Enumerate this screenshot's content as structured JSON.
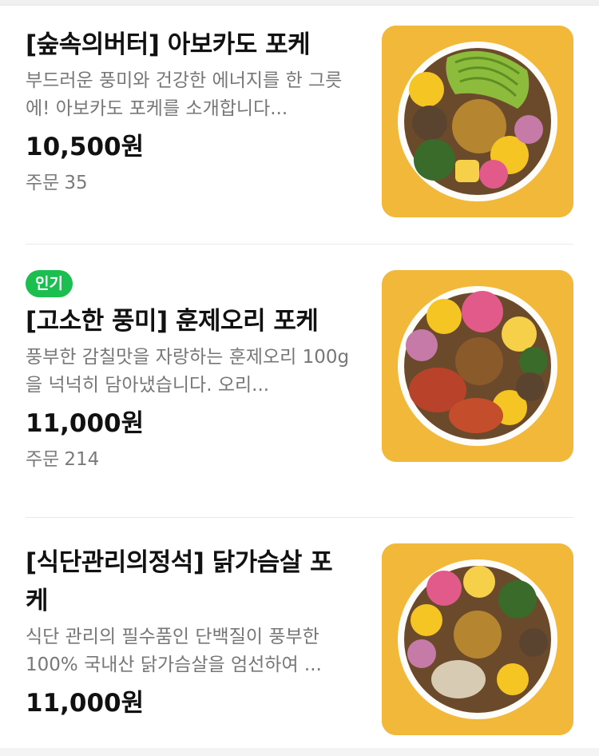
{
  "menu_items": [
    {
      "badge": "",
      "title": "[숲속의버터] 아보카도 포케",
      "description": "부드러운 풍미와 건강한 에너지를 한 그릇에! 아보카도 포케를 소개합니다...",
      "price": "10,500원",
      "orders_label": "주문",
      "orders_count": "35",
      "image_icon": "avocado-poke-bowl-photo"
    },
    {
      "badge": "인기",
      "title": "[고소한 풍미] 훈제오리 포케",
      "description": "풍부한 감칠맛을 자랑하는 훈제오리 100g을 넉넉히 담아냈습니다. 오리...",
      "price": "11,000원",
      "orders_label": "주문",
      "orders_count": "214",
      "image_icon": "smoked-duck-poke-bowl-photo"
    },
    {
      "badge": "",
      "title": "[식단관리의정석] 닭가슴살 포케",
      "description": "식단 관리의 필수품인 단백질이 풍부한 100% 국내산 닭가슴살을 엄선하여 ...",
      "price": "11,000원",
      "orders_label": "",
      "orders_count": "",
      "image_icon": "chicken-breast-poke-bowl-photo"
    }
  ],
  "colors": {
    "badge_bg": "#1bbf4f",
    "thumb_bg": "#f2b83a",
    "text_primary": "#111111",
    "text_secondary": "#777777"
  }
}
